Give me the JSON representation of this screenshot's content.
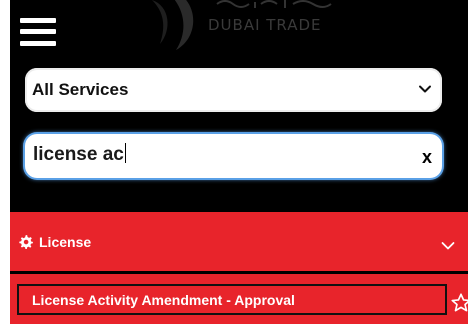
{
  "header": {
    "menu_icon": "hamburger-menu-icon",
    "logo": {
      "name": "dubai-trade-logo",
      "text": "DUBAI TRADE"
    }
  },
  "service_filter": {
    "selected": "All Services",
    "icon": "chevron-down-icon"
  },
  "search": {
    "value": "license ac",
    "clear_label": "x"
  },
  "category": {
    "icon": "gear-icon",
    "label": "License",
    "chevron_icon": "chevron-down-icon"
  },
  "results": [
    {
      "label": "License Activity Amendment - Approval",
      "favorite_icon": "star-outline-icon"
    }
  ],
  "colors": {
    "accent_red": "#e8242b",
    "background": "#000000",
    "focus_blue": "#5aa0e6"
  }
}
